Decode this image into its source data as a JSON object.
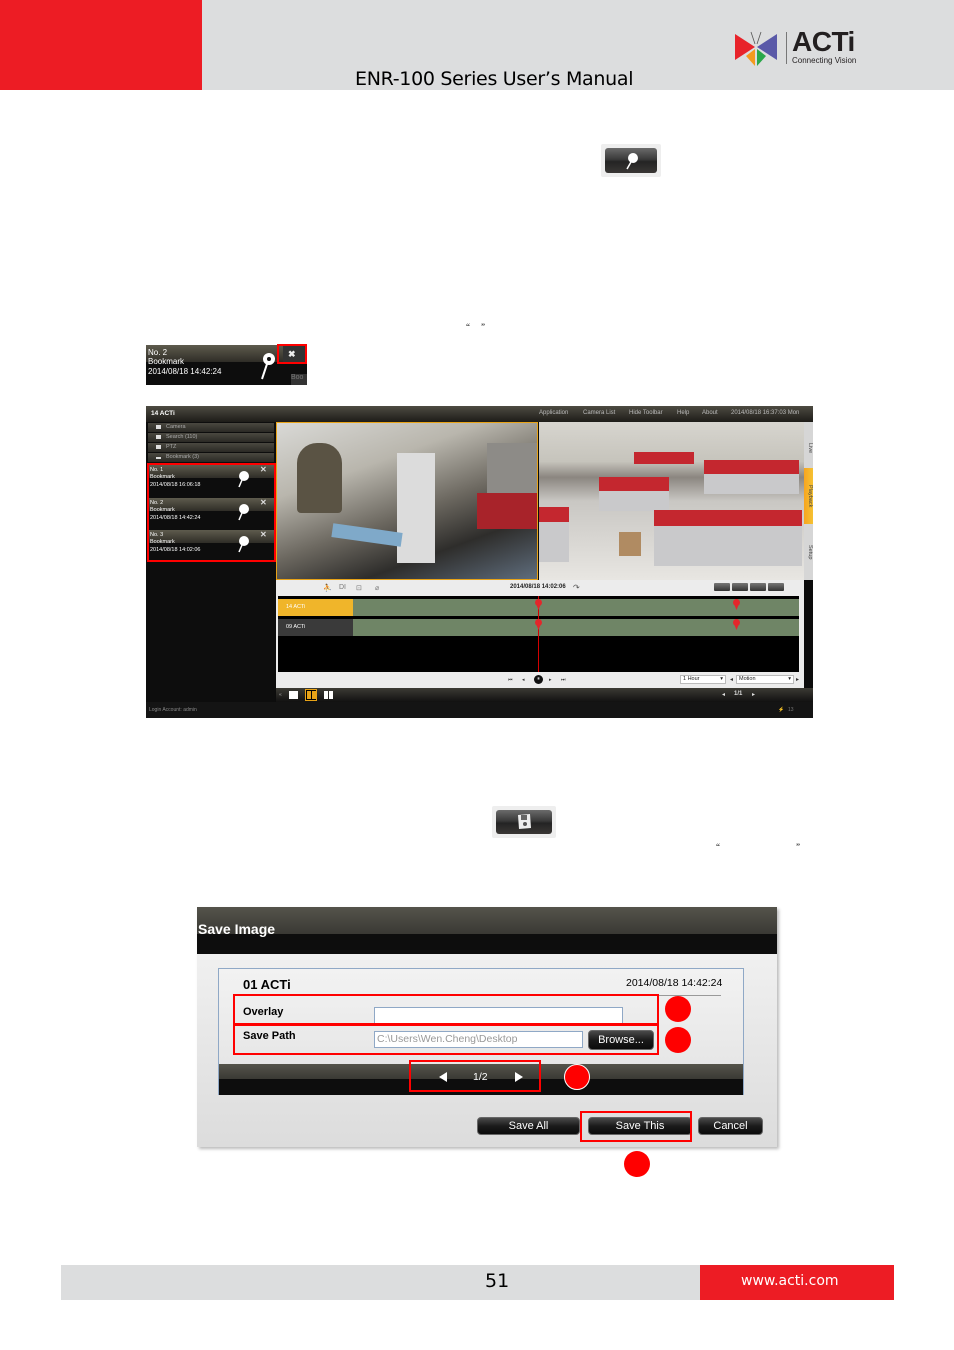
{
  "header": {
    "manual_title": "ENR-100 Series User’s Manual",
    "logo": {
      "brand": "ACTi",
      "tagline": "Connecting Vision",
      "icon": "acti-butterfly-logo"
    },
    "colors": {
      "brand_red": "#ed1c24",
      "band_gray": "#dcddde"
    }
  },
  "inline_icons": {
    "bookmark_button": "bookmark-pin-icon",
    "save_image_button": "floppy-disk-icon",
    "quote_open": "“",
    "quote_close": "”"
  },
  "bookmark_example": {
    "number": "No. 2",
    "label": "Bookmark",
    "timestamp": "2014/08/18 14:42:24",
    "close_symbol": "✖",
    "partial_text": "Boo"
  },
  "nvr_screenshot": {
    "title": "14 ACTi",
    "menu": [
      "Application",
      "Camera List",
      "Hide Toolbar",
      "Help",
      "About"
    ],
    "clock": "2014/08/18 16:37:03 Mon",
    "sidebar": [
      {
        "label": "Camera"
      },
      {
        "label": "Search (110)"
      },
      {
        "label": "PTZ"
      },
      {
        "label": "Bookmark (3)"
      }
    ],
    "bookmarks": [
      {
        "number": "No. 1",
        "label": "Bookmark",
        "timestamp": "2014/08/18 16:06:18"
      },
      {
        "number": "No. 2",
        "label": "Bookmark",
        "timestamp": "2014/08/18 14:42:24"
      },
      {
        "number": "No. 3",
        "label": "Bookmark",
        "timestamp": "2014/08/18 14:02:06"
      }
    ],
    "side_tabs": [
      "Live",
      "Playback",
      "Setup"
    ],
    "active_tab": "Playback",
    "timeline": {
      "icons": [
        "motion-icon",
        "DI",
        "alarm-icon",
        "tamper-icon"
      ],
      "current_time": "2014/08/18 14:02:06",
      "rows": [
        {
          "camera": "14 ACTi",
          "active": true
        },
        {
          "camera": "09 ACTi",
          "active": false
        }
      ],
      "range": "1 Hour",
      "event_filter": "Motion",
      "playback_controls": [
        "⏮",
        "◂",
        "⏸",
        "▸",
        "⏭"
      ],
      "colors": {
        "recording": "#6f8566",
        "active_camera": "#f0b52a",
        "cursor": "#d40000"
      }
    },
    "layout_page": "1/1",
    "status_count": "13",
    "login": "Login Account: admin"
  },
  "save_dialog": {
    "title": "Save Image",
    "camera": "01 ACTi",
    "timestamp": "2014/08/18 14:42:24",
    "overlay_label": "Overlay",
    "overlay_value": "",
    "save_path_label": "Save Path",
    "save_path_value": "C:\\Users\\Wen.Cheng\\Desktop",
    "browse_label": "Browse...",
    "pager": "1/2",
    "buttons": {
      "save_all": "Save All",
      "save_this": "Save This",
      "cancel": "Cancel"
    }
  },
  "footer": {
    "page_number": "51",
    "url": "www.acti.com"
  }
}
